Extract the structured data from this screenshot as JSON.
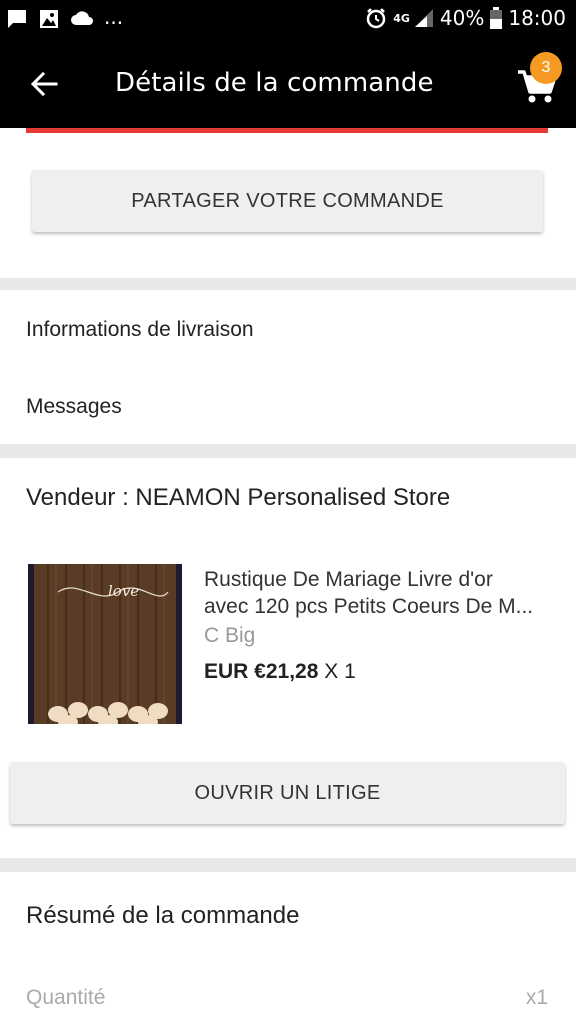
{
  "status_bar": {
    "ellipsis": "...",
    "network": "4G",
    "battery": "40%",
    "time": "18:00",
    "icons": [
      "chat-icon",
      "image-icon",
      "cloud-icon",
      "alarm-icon",
      "signal-icon",
      "battery-icon"
    ]
  },
  "app_bar": {
    "title": "Détails de la commande",
    "cart_count": "3",
    "icons": [
      "back-arrow-icon",
      "cart-icon"
    ]
  },
  "share": {
    "button_label": "PARTAGER VOTRE COMMANDE"
  },
  "info_links": [
    {
      "label": "Informations de livraison"
    },
    {
      "label": "Messages"
    }
  ],
  "seller": {
    "label": "Vendeur : NEAMON Personalised Store"
  },
  "product": {
    "title_line1": "Rustique De Mariage Livre d'or",
    "title_line2": "avec 120 pcs Petits Coeurs De M...",
    "variant": "C Big",
    "price": "EUR €21,28",
    "quantity": "X 1",
    "image_text": "love"
  },
  "dispute": {
    "button_label": "OUVRIR UN LITIGE"
  },
  "summary": {
    "title": "Résumé de la commande",
    "quantity_label": "Quantité",
    "quantity_value": "x1"
  },
  "colors": {
    "accent_red": "#e53935",
    "badge_orange": "#f59a23",
    "bar_black": "#000000"
  }
}
